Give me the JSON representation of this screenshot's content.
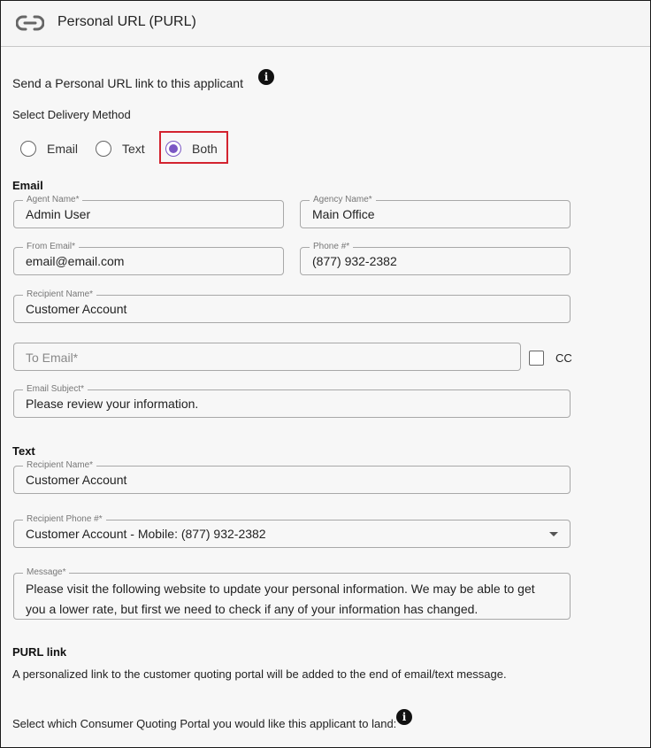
{
  "header": {
    "title": "Personal URL (PURL)",
    "icon": "link-icon"
  },
  "intro": {
    "text": "Send a Personal URL link to this applicant"
  },
  "delivery": {
    "label": "Select Delivery Method",
    "options": [
      "Email",
      "Text",
      "Both"
    ],
    "selected": "Both"
  },
  "email_section": {
    "title": "Email",
    "agent_name": {
      "label": "Agent Name*",
      "value": "Admin User"
    },
    "agency_name": {
      "label": "Agency Name*",
      "value": "Main Office"
    },
    "from_email": {
      "label": "From Email*",
      "value": "email@email.com"
    },
    "phone": {
      "label": "Phone #*",
      "value": "(877) 932-2382"
    },
    "recipient_name": {
      "label": "Recipient Name*",
      "value": "Customer Account"
    },
    "to_email": {
      "placeholder": "To Email*",
      "value": ""
    },
    "cc": {
      "label": "CC",
      "checked": false
    },
    "subject": {
      "label": "Email Subject*",
      "value": "Please review your information."
    }
  },
  "text_section": {
    "title": "Text",
    "recipient_name": {
      "label": "Recipient Name*",
      "value": "Customer Account"
    },
    "recipient_phone": {
      "label": "Recipient Phone #*",
      "value": "Customer Account - Mobile: (877) 932-2382"
    },
    "message": {
      "label": "Message*",
      "value": "Please visit the following website to update your personal information. We may be able to get you a lower rate, but first we need to check if any of your information has changed."
    }
  },
  "purl_section": {
    "title": "PURL link",
    "description": "A personalized link to the customer quoting portal will be added to the end of email/text message.",
    "portal_prompt": "Select which Consumer Quoting Portal you would like this applicant to land:"
  },
  "colors": {
    "accent": "#7b57c4",
    "highlight": "#d3232f"
  }
}
